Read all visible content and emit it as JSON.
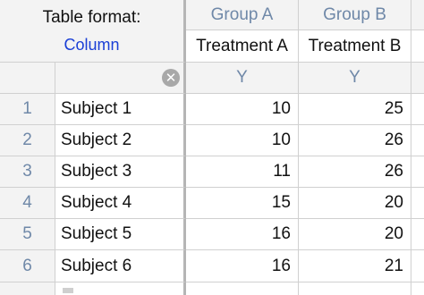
{
  "corner": {
    "table_format_label": "Table format:",
    "table_format_value": "Column"
  },
  "columns": [
    {
      "group": "Group A",
      "title": "Treatment A",
      "subheader": "Y"
    },
    {
      "group": "Group B",
      "title": "Treatment B",
      "subheader": "Y"
    }
  ],
  "clear_icon": "clear-icon",
  "rows": [
    {
      "num": "1",
      "name": "Subject 1",
      "a": "10",
      "b": "25"
    },
    {
      "num": "2",
      "name": "Subject 2",
      "a": "10",
      "b": "26"
    },
    {
      "num": "3",
      "name": "Subject 3",
      "a": "11",
      "b": "26"
    },
    {
      "num": "4",
      "name": "Subject 4",
      "a": "15",
      "b": "20"
    },
    {
      "num": "5",
      "name": "Subject 5",
      "a": "16",
      "b": "20"
    },
    {
      "num": "6",
      "name": "Subject 6",
      "a": "16",
      "b": "21"
    }
  ]
}
